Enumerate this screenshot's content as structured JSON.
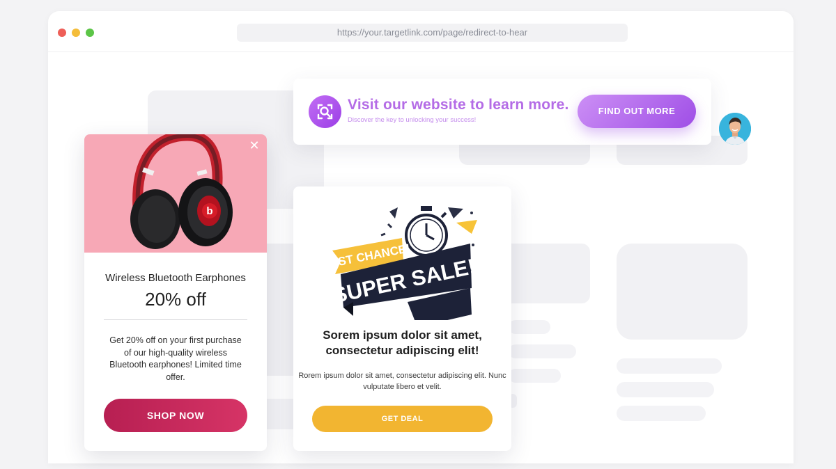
{
  "browser": {
    "url": "https://your.targetlink.com/page/redirect-to-hear"
  },
  "banner": {
    "title": "Visit our website to learn more.",
    "subtitle": "Discover the key to unlocking your success!",
    "button_label": "FIND OUT MORE",
    "icon": "search-scan-icon",
    "accent_color": "#b46ce6"
  },
  "product_card": {
    "image": "headphones-image",
    "brand_mark": "b",
    "name": "Wireless Bluetooth Earphones",
    "discount": "20% off",
    "description": "Get 20% off on your first purchase of our high-quality wireless Bluetooth earphones! Limited time offer.",
    "button_label": "SHOP NOW",
    "close_icon": "close-icon",
    "image_bg": "#f7a8b6",
    "button_color": "#c22a5c"
  },
  "sale_card": {
    "art_line1": "LAST CHANCE!",
    "art_line2": "SUPER SALE!",
    "title": "Sorem ipsum dolor sit amet, consectetur adipiscing elit!",
    "description": "Rorem ipsum dolor sit amet, consectetur adipiscing elit. Nunc vulputate libero et velit.",
    "button_label": "GET DEAL",
    "button_color": "#f2b531"
  }
}
